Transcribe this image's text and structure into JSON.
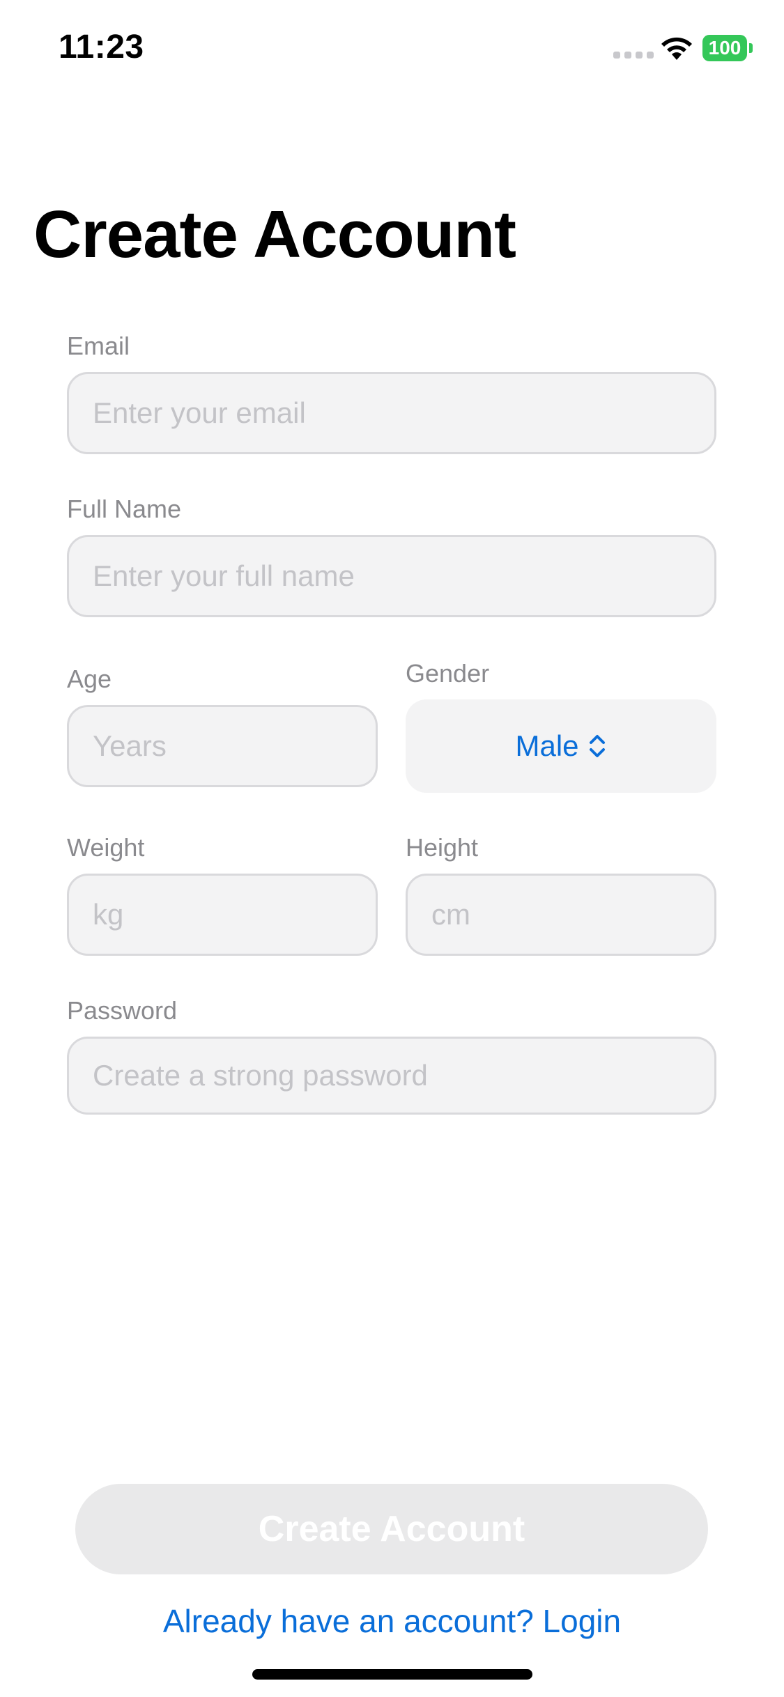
{
  "status_bar": {
    "time": "11:23",
    "battery": "100",
    "battery_color": "#34c759"
  },
  "page": {
    "title": "Create Account"
  },
  "form": {
    "email": {
      "label": "Email",
      "placeholder": "Enter your email"
    },
    "full_name": {
      "label": "Full Name",
      "placeholder": "Enter your full name"
    },
    "age": {
      "label": "Age",
      "placeholder": "Years"
    },
    "gender": {
      "label": "Gender",
      "value": "Male",
      "icon": "chevron-updown-icon"
    },
    "weight": {
      "label": "Weight",
      "placeholder": "kg"
    },
    "height": {
      "label": "Height",
      "placeholder": "cm"
    },
    "password": {
      "label": "Password",
      "placeholder": "Create a strong password"
    }
  },
  "actions": {
    "create_label": "Create Account",
    "login_link": "Already have an account? Login"
  },
  "colors": {
    "accent": "#0a6ed9",
    "button_disabled_bg": "#e9e9ea"
  }
}
